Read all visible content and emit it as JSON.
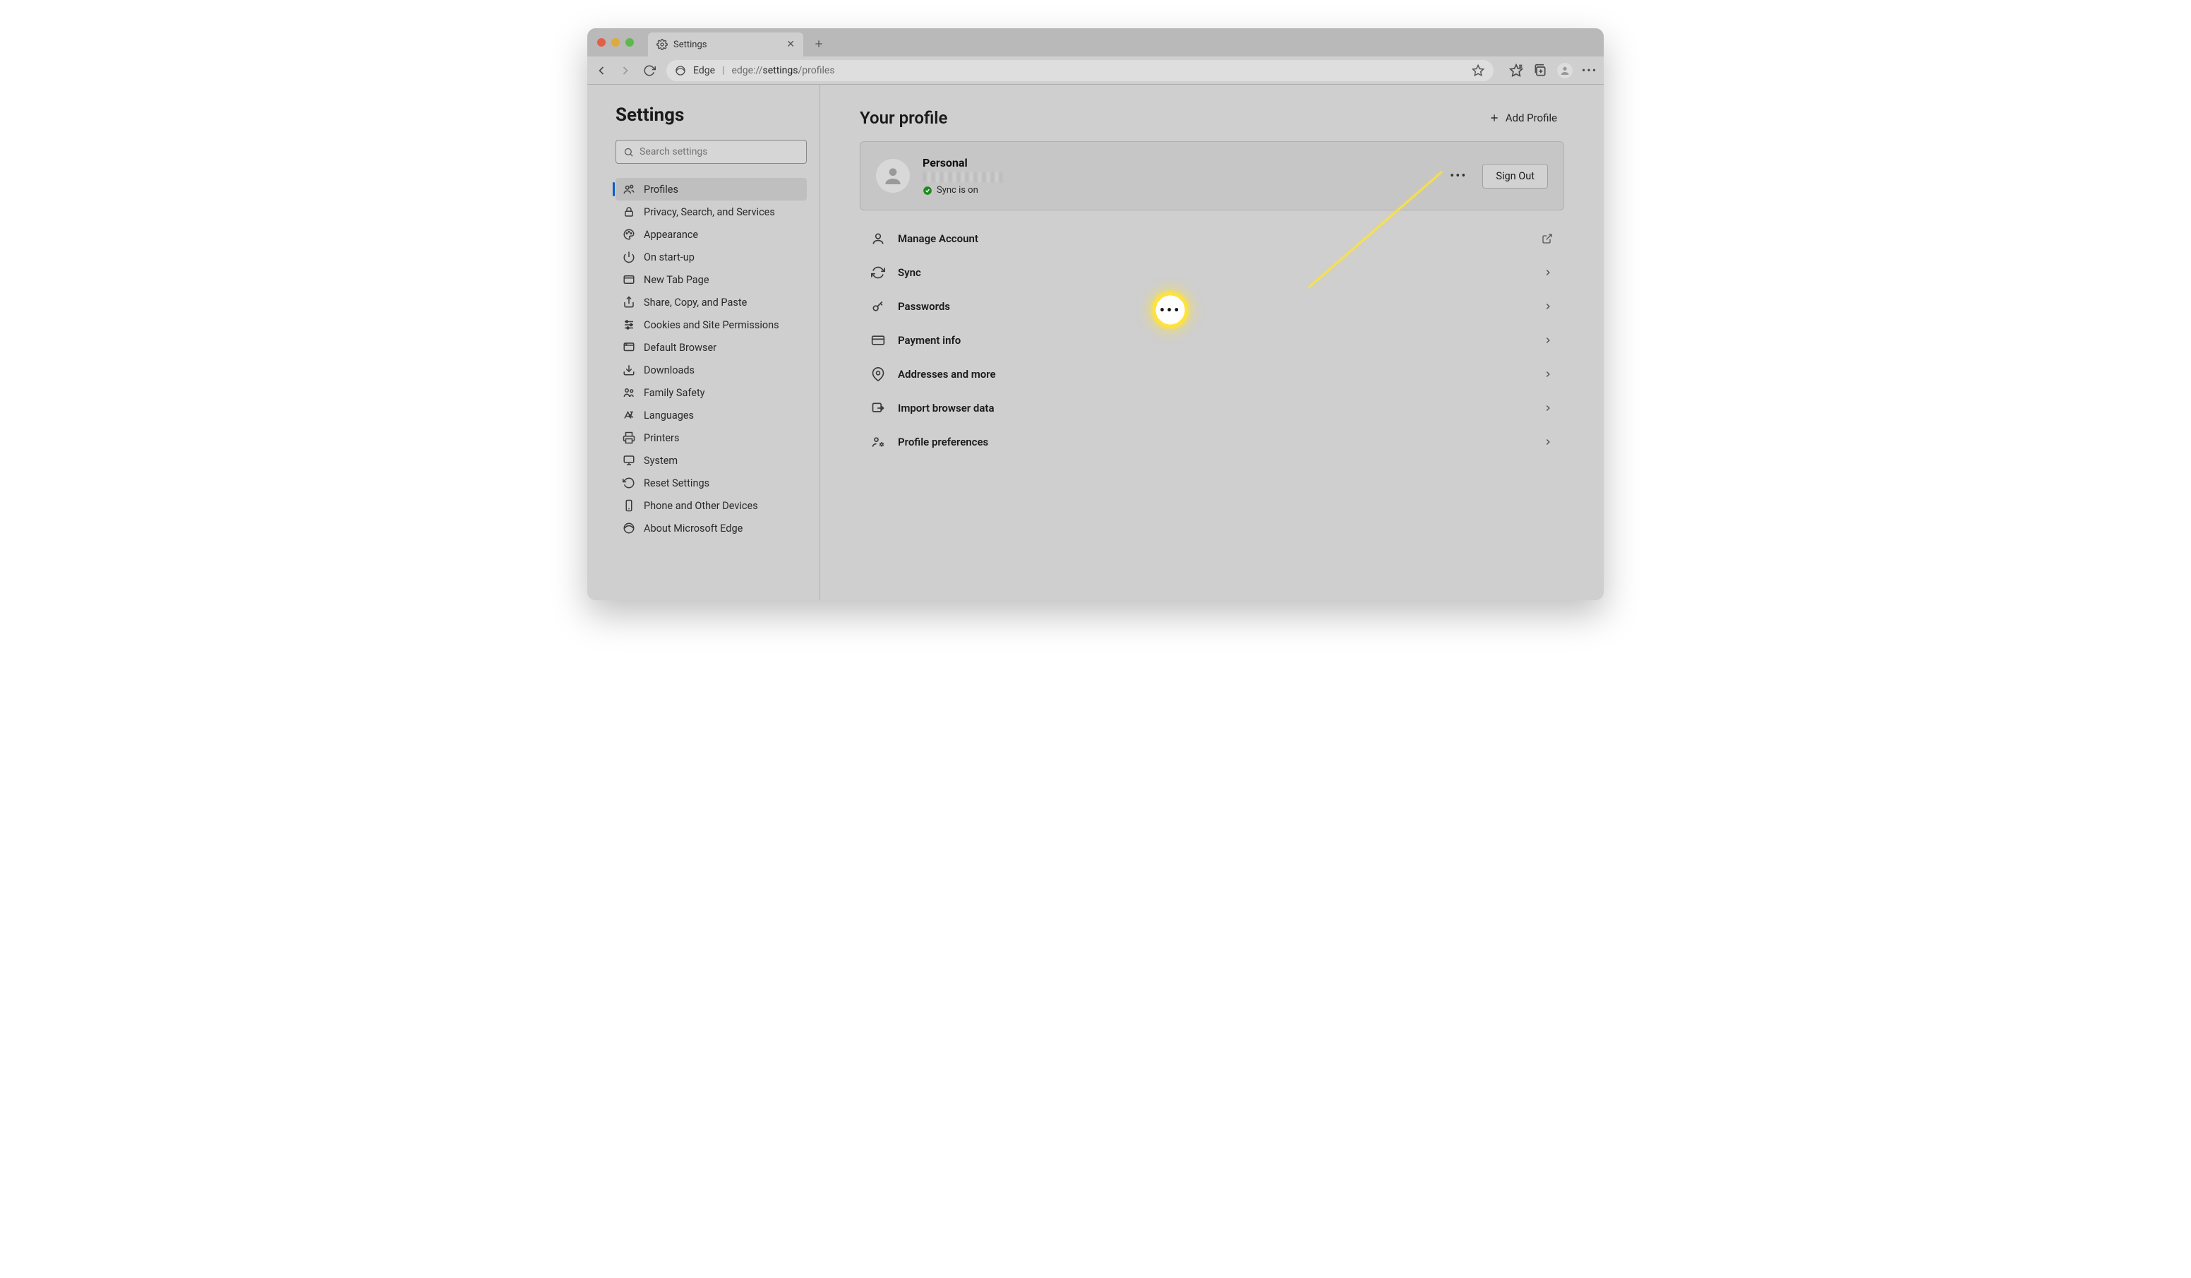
{
  "tab": {
    "title": "Settings"
  },
  "address": {
    "brand": "Edge",
    "url_prefix": "edge://",
    "url_bold": "settings",
    "url_suffix": "/profiles"
  },
  "sidebar_title": "Settings",
  "search": {
    "placeholder": "Search settings"
  },
  "nav": [
    {
      "label": "Profiles"
    },
    {
      "label": "Privacy, Search, and Services"
    },
    {
      "label": "Appearance"
    },
    {
      "label": "On start-up"
    },
    {
      "label": "New Tab Page"
    },
    {
      "label": "Share, Copy, and Paste"
    },
    {
      "label": "Cookies and Site Permissions"
    },
    {
      "label": "Default Browser"
    },
    {
      "label": "Downloads"
    },
    {
      "label": "Family Safety"
    },
    {
      "label": "Languages"
    },
    {
      "label": "Printers"
    },
    {
      "label": "System"
    },
    {
      "label": "Reset Settings"
    },
    {
      "label": "Phone and Other Devices"
    },
    {
      "label": "About Microsoft Edge"
    }
  ],
  "main": {
    "heading": "Your profile",
    "add_profile": "Add Profile",
    "profile_name": "Personal",
    "sync_status": "Sync is on",
    "signout": "Sign Out",
    "rows": [
      {
        "label": "Manage Account",
        "action": "external"
      },
      {
        "label": "Sync",
        "action": "chevron"
      },
      {
        "label": "Passwords",
        "action": "chevron"
      },
      {
        "label": "Payment info",
        "action": "chevron"
      },
      {
        "label": "Addresses and more",
        "action": "chevron"
      },
      {
        "label": "Import browser data",
        "action": "chevron"
      },
      {
        "label": "Profile preferences",
        "action": "chevron"
      }
    ]
  },
  "annotation": {
    "glyph": "•••"
  }
}
